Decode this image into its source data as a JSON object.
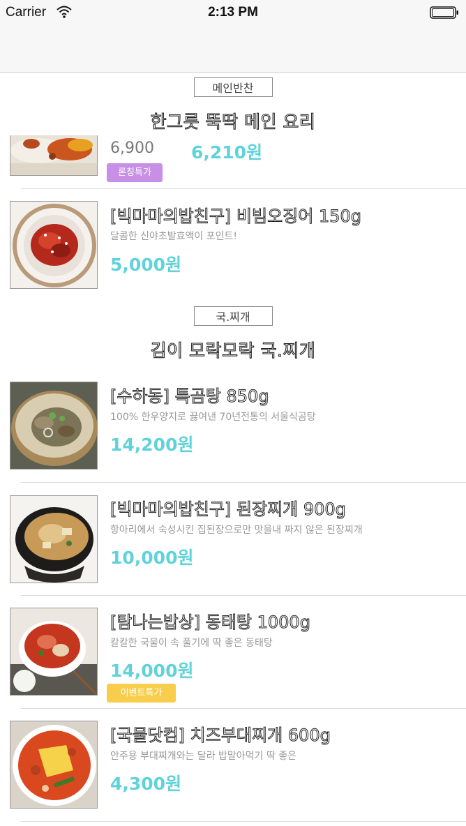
{
  "status": {
    "carrier": "Carrier",
    "time": "2:13 PM"
  },
  "sections": [
    {
      "tag": "메인반찬",
      "title": "한그릇 뚝딱 메인 요리"
    },
    {
      "tag": "국.찌개",
      "title": "김이 모락모락 국.찌개"
    }
  ],
  "partial_item": {
    "original_price": "6,900",
    "price": "6,210원",
    "badge": "론칭특가",
    "badge_color": "#c790e6"
  },
  "items": [
    {
      "title": "[빅마마의밥친구] 비빔오징어 150g",
      "desc": "달콤한 신야초발효액이 포인트!",
      "price": "5,000원",
      "image": "squid-bowl"
    },
    {
      "title": "[수하동] 특곰탕 850g",
      "desc": "100% 한우양지로 끓여낸 70년전통의 서울식곰탕",
      "price": "14,200원",
      "image": "gomtang-bowl"
    },
    {
      "title": "[빅마마의밥친구] 된장찌개 900g",
      "desc": "항아리에서 숙성시킨 집된장으로만 맛을내 짜지 않은 된장찌개",
      "price": "10,000원",
      "image": "doenjang-pot"
    },
    {
      "title": "[탐나는밥상] 동태탕 1000g",
      "desc": "칼칼한 국물이 속 풀기에 딱 좋은 동태탕",
      "price": "14,000원",
      "image": "dongtae-bowl",
      "badge": "이벤트특가",
      "badge_color": "#f7cd4b"
    },
    {
      "title": "[국물닷컴] 치즈부대찌개 600g",
      "desc": "안주용 부대찌개와는 달라 밥말아먹기 딱 좋은",
      "price": "4,300원",
      "image": "budae-bowl"
    }
  ],
  "colors": {
    "price": "#5fd3d9",
    "nav_bg": "#f7f7f7"
  }
}
